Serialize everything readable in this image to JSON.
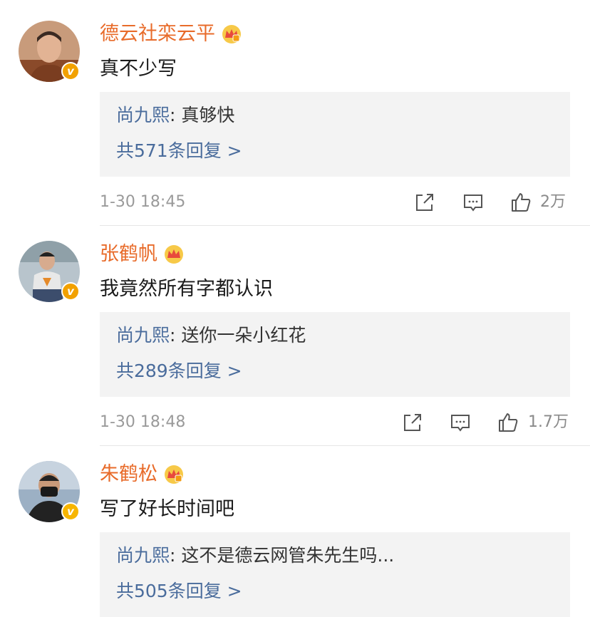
{
  "comments": [
    {
      "username": "德云社栾云平",
      "text": "真不少写",
      "verified_color": "#f2a100",
      "reply": {
        "user": "尚九熙",
        "text": "真够快"
      },
      "more_replies": "共571条回复 >",
      "time": "1-30 18:45",
      "likes": "2万"
    },
    {
      "username": "张鹤帆",
      "text": "我竟然所有字都认识",
      "verified_color": "#f2a100",
      "reply": {
        "user": "尚九熙",
        "text": "送你一朵小红花"
      },
      "more_replies": "共289条回复 >",
      "time": "1-30 18:48",
      "likes": "1.7万"
    },
    {
      "username": "朱鹤松",
      "text": "写了好长时间吧",
      "verified_color": "#f7b500",
      "reply": {
        "user": "尚九熙",
        "text": "这不是德云网管朱先生吗..."
      },
      "more_replies": "共505条回复 >"
    }
  ],
  "ui": {
    "separator": ": ",
    "verified_letter": "v",
    "accent_username": "#e86b2a",
    "link_blue": "#4a6c9c"
  }
}
